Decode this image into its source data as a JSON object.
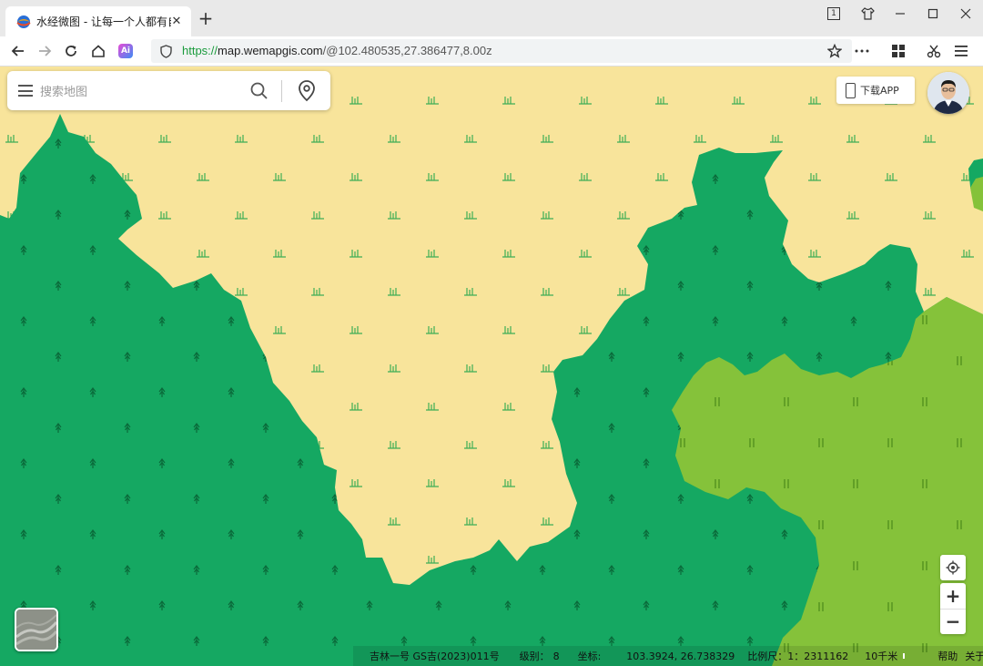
{
  "browser": {
    "tab_title": "水经微图 - 让每一个人都有自",
    "close_tab": "✕",
    "new_tab": "+",
    "url_scheme": "https://",
    "url_host": "map.wemapgis.com",
    "url_path": "/@102.480535,27.386477,8.00z",
    "window_badge": "1",
    "ai_label": "Ai"
  },
  "search": {
    "placeholder": "搜索地图"
  },
  "header": {
    "download_label": "下载APP"
  },
  "controls": {
    "zoom_in": "+",
    "zoom_out": "−"
  },
  "status": {
    "source": "吉林一号 GS吉(2023)011号",
    "level_label": "级别：",
    "level_value": "8",
    "coord_label": "坐标:",
    "coord_value": "103.3924, 26.738329",
    "scale_label": "比例尺：",
    "scale_value": "1：2311162",
    "scale_bar_label": "10千米",
    "help": "帮助",
    "about": "关于"
  },
  "colors": {
    "grassland": "#f8e49b",
    "forest": "#15a862",
    "shrubland": "#85c23a",
    "url_green": "#1a9b3c"
  },
  "icons": {
    "grassland_symbol": "grass-icon",
    "forest_symbol": "tree-icon",
    "shrub_symbol": "shrub-icon"
  }
}
